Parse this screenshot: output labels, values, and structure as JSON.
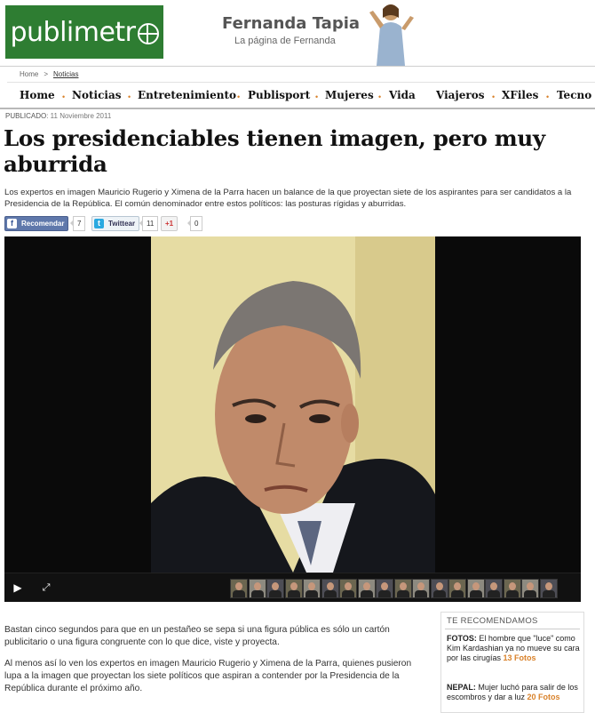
{
  "header": {
    "logo_text": "publimetr",
    "promo_name": "Fernanda Tapia",
    "promo_tagline": "La página de Fernanda"
  },
  "breadcrumb": [
    "Home",
    ">",
    "Noticias"
  ],
  "nav": [
    "Home",
    "Noticias",
    "Entretenimiento",
    "Publisport",
    "Mujeres",
    "Vida",
    "Viajeros",
    "XFiles",
    "Tecno"
  ],
  "article": {
    "published_label": "PUBLICADO",
    "published_date": ": 11 Noviembre 2011",
    "headline": "Los presidenciables tienen imagen, pero muy aburrida",
    "lede": "Los expertos en imagen Mauricio Rugerio y Ximena de la Parra hacen un balance de la que proyectan siete de los aspirantes para ser candidatos a la Presidencia de la República. El común denominador entre estos políticos: las posturas rígidas y aburridas.",
    "body": [
      "Bastan cinco segundos para que en un pestañeo se sepa si una figura pública es sólo un cartón publicitario o una figura congruente con lo que dice, viste y proyecta.",
      "Al menos así lo ven los expertos en imagen Mauricio Rugerio y Ximena de la Parra, quienes pusieron lupa a la imagen  que proyectan los siete políticos que aspiran a contender por la Presidencia de la República durante el próximo año."
    ]
  },
  "share": {
    "facebook_label": "Recomendar",
    "facebook_count": "7",
    "twitter_label": "Twittear",
    "twitter_count": "11",
    "gplus_label": "+1",
    "gplus_count": "0"
  },
  "player": {
    "play_icon": "play-icon",
    "fullscreen_icon": "fullscreen-icon",
    "thumbnail_count": 18
  },
  "sidebar": {
    "title": "TE RECOMENDAMOS",
    "items": [
      {
        "tag": "FOTOS:",
        "text": " El hombre que \"luce\" como Kim Kardashian ya no mueve su cara por las cirugías ",
        "fotos": "13 Fotos"
      },
      {
        "tag": "NEPAL:",
        "text": " Mujer luchó para salir de los escombros y dar a luz ",
        "fotos": "20 Fotos"
      }
    ]
  },
  "colors": {
    "brand_green": "#2e7d32",
    "accent_orange": "#d9822b",
    "facebook_blue": "#5f78ab"
  }
}
